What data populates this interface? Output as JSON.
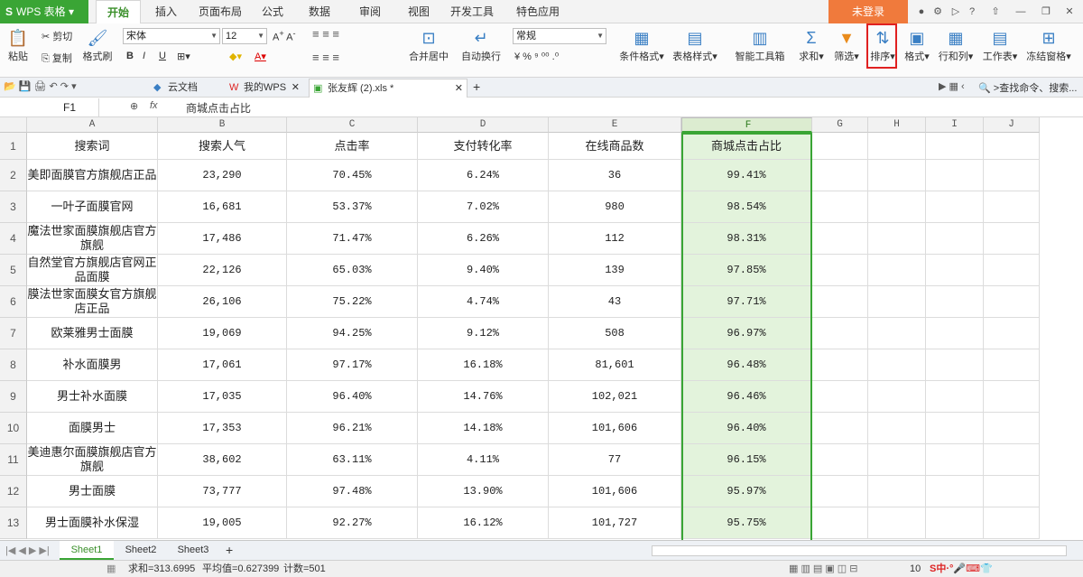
{
  "app": {
    "name": "WPS 表格",
    "logo": "S"
  },
  "menu": {
    "tabs": [
      "开始",
      "插入",
      "页面布局",
      "公式",
      "数据",
      "审阅",
      "视图",
      "开发工具",
      "特色应用"
    ],
    "login": "未登录"
  },
  "ribbon": {
    "paste": "粘贴",
    "cut": "剪切",
    "copy": "复制",
    "format_painter": "格式刷",
    "font_name": "宋体",
    "font_size": "12",
    "merge": "合并居中",
    "wrap": "自动换行",
    "number_format": "常规",
    "cond_format": "条件格式",
    "table_style": "表格样式",
    "smart_toolbox": "智能工具箱",
    "sum": "求和",
    "filter": "筛选",
    "sort": "排序",
    "format": "格式",
    "row_col": "行和列",
    "worksheet": "工作表",
    "freeze": "冻结窗格"
  },
  "doctabs": {
    "items": [
      {
        "label": "云文档"
      },
      {
        "label": "我的WPS"
      },
      {
        "label": "张友辉 (2).xls *"
      }
    ],
    "search_placeholder": "查找命令、搜索..."
  },
  "formula_bar": {
    "cell_ref": "F1",
    "fx": "fx",
    "content": "商城点击占比"
  },
  "columns": [
    "A",
    "B",
    "C",
    "D",
    "E",
    "F",
    "G",
    "H",
    "I",
    "J"
  ],
  "rows": [
    {
      "n": "1",
      "cells": [
        "搜索词",
        "搜索人气",
        "点击率",
        "支付转化率",
        "在线商品数",
        "商城点击占比"
      ]
    },
    {
      "n": "2",
      "cells": [
        "美即面膜官方旗舰店正品",
        "23,290",
        "70.45%",
        "6.24%",
        "36",
        "99.41%"
      ]
    },
    {
      "n": "3",
      "cells": [
        "一叶子面膜官网",
        "16,681",
        "53.37%",
        "7.02%",
        "980",
        "98.54%"
      ]
    },
    {
      "n": "4",
      "cells": [
        "魔法世家面膜旗舰店官方旗舰",
        "17,486",
        "71.47%",
        "6.26%",
        "112",
        "98.31%"
      ]
    },
    {
      "n": "5",
      "cells": [
        "自然堂官方旗舰店官网正品面膜",
        "22,126",
        "65.03%",
        "9.40%",
        "139",
        "97.85%"
      ]
    },
    {
      "n": "6",
      "cells": [
        "膜法世家面膜女官方旗舰店正品",
        "26,106",
        "75.22%",
        "4.74%",
        "43",
        "97.71%"
      ]
    },
    {
      "n": "7",
      "cells": [
        "欧莱雅男士面膜",
        "19,069",
        "94.25%",
        "9.12%",
        "508",
        "96.97%"
      ]
    },
    {
      "n": "8",
      "cells": [
        "补水面膜男",
        "17,061",
        "97.17%",
        "16.18%",
        "81,601",
        "96.48%"
      ]
    },
    {
      "n": "9",
      "cells": [
        "男士补水面膜",
        "17,035",
        "96.40%",
        "14.76%",
        "102,021",
        "96.46%"
      ]
    },
    {
      "n": "10",
      "cells": [
        "面膜男士",
        "17,353",
        "96.21%",
        "14.18%",
        "101,606",
        "96.40%"
      ]
    },
    {
      "n": "11",
      "cells": [
        "美迪惠尔面膜旗舰店官方旗舰",
        "38,602",
        "63.11%",
        "4.11%",
        "77",
        "96.15%"
      ]
    },
    {
      "n": "12",
      "cells": [
        "男士面膜",
        "73,777",
        "97.48%",
        "13.90%",
        "101,606",
        "95.97%"
      ]
    },
    {
      "n": "13",
      "cells": [
        "男士面膜补水保湿",
        "19,005",
        "92.27%",
        "16.12%",
        "101,727",
        "95.75%"
      ]
    }
  ],
  "sheets": [
    "Sheet1",
    "Sheet2",
    "Sheet3"
  ],
  "status": {
    "sum": "求和=313.6995",
    "avg": "平均值=0.627399",
    "count": "计数=501",
    "zoom": "10"
  },
  "colors": {
    "brand": "#3aa535",
    "selected": "#e3f3dc",
    "login": "#f07a3c",
    "highlight": "#e02020"
  }
}
